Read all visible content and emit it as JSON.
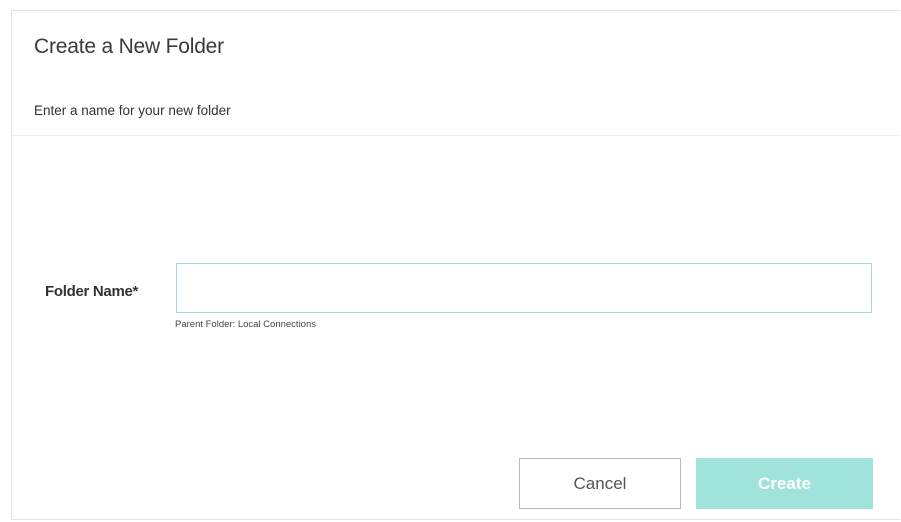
{
  "dialog": {
    "title": "Create a New Folder",
    "subtitle": "Enter a name for your new folder"
  },
  "form": {
    "folder_name_label": "Folder Name*",
    "folder_name_value": "",
    "folder_name_placeholder": "",
    "parent_folder_hint": "Parent Folder: Local Connections"
  },
  "actions": {
    "cancel_label": "Cancel",
    "create_label": "Create",
    "create_disabled": true
  },
  "colors": {
    "accent": "#9fe3da",
    "input_border": "#a9d8dc"
  }
}
